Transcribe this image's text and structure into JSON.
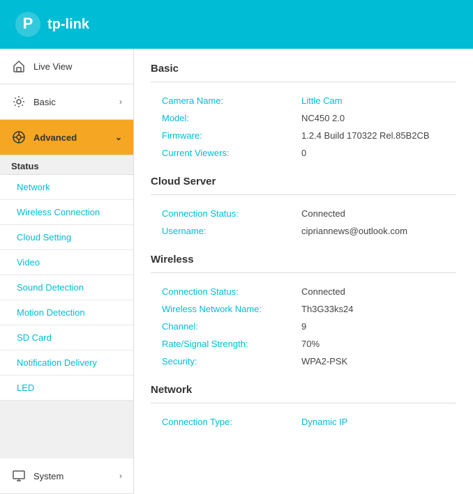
{
  "header": {
    "brand": "tp-link"
  },
  "sidebar": {
    "items": [
      {
        "id": "live-view",
        "label": "Live View",
        "icon": "home",
        "hasChevron": false,
        "active": false
      },
      {
        "id": "basic",
        "label": "Basic",
        "icon": "gear",
        "hasChevron": true,
        "active": false
      },
      {
        "id": "advanced",
        "label": "Advanced",
        "icon": "wrench",
        "hasChevron": true,
        "active": true
      }
    ],
    "status_section": "Status",
    "sub_items": [
      {
        "id": "network",
        "label": "Network"
      },
      {
        "id": "wireless-connection",
        "label": "Wireless Connection"
      },
      {
        "id": "cloud-setting",
        "label": "Cloud Setting"
      },
      {
        "id": "video",
        "label": "Video"
      },
      {
        "id": "sound-detection",
        "label": "Sound Detection"
      },
      {
        "id": "motion-detection",
        "label": "Motion Detection"
      },
      {
        "id": "sd-card",
        "label": "SD Card"
      },
      {
        "id": "notification-delivery",
        "label": "Notification Delivery"
      },
      {
        "id": "led",
        "label": "LED"
      }
    ],
    "system_item": {
      "label": "System",
      "icon": "monitor",
      "hasChevron": true
    }
  },
  "content": {
    "sections": [
      {
        "id": "basic",
        "title": "Basic",
        "rows": [
          {
            "label": "Camera Name:",
            "value": "Little Cam",
            "valueClass": "link-color"
          },
          {
            "label": "Model:",
            "value": "NC450 2.0",
            "valueClass": ""
          },
          {
            "label": "Firmware:",
            "value": "1.2.4 Build 170322 Rel.85B2CB",
            "valueClass": ""
          },
          {
            "label": "Current Viewers:",
            "value": "0",
            "valueClass": ""
          }
        ]
      },
      {
        "id": "cloud-server",
        "title": "Cloud Server",
        "rows": [
          {
            "label": "Connection Status:",
            "value": "Connected",
            "valueClass": ""
          },
          {
            "label": "Username:",
            "value": "cipriannews@outlook.com",
            "valueClass": ""
          }
        ]
      },
      {
        "id": "wireless",
        "title": "Wireless",
        "rows": [
          {
            "label": "Connection Status:",
            "value": "Connected",
            "valueClass": ""
          },
          {
            "label": "Wireless Network Name:",
            "value": "Th3G33ks24",
            "valueClass": ""
          },
          {
            "label": "Channel:",
            "value": "9",
            "valueClass": ""
          },
          {
            "label": "Rate/Signal Strength:",
            "value": "70%",
            "valueClass": ""
          },
          {
            "label": "Security:",
            "value": "WPA2-PSK",
            "valueClass": ""
          }
        ]
      },
      {
        "id": "network",
        "title": "Network",
        "rows": [
          {
            "label": "Connection Type:",
            "value": "Dynamic IP",
            "valueClass": "link-color"
          }
        ]
      }
    ]
  }
}
